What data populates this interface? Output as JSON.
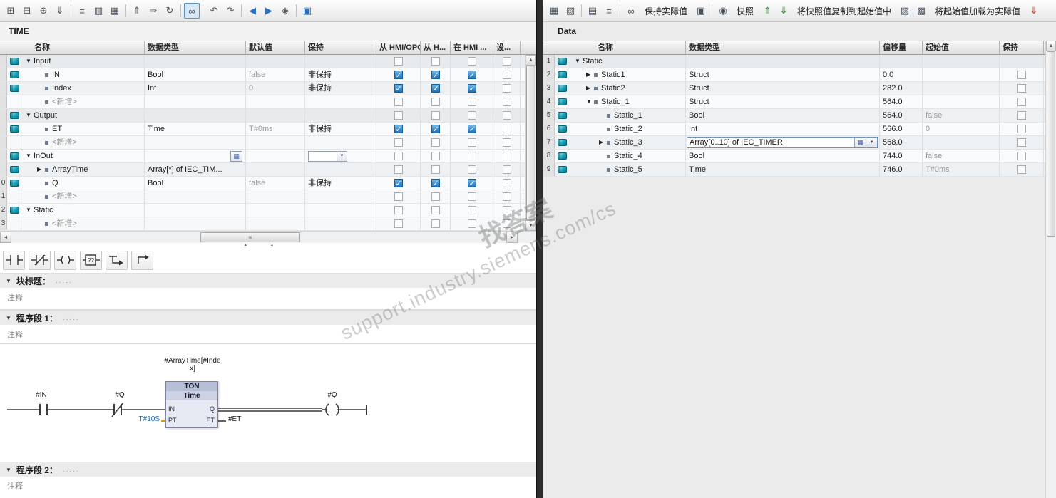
{
  "watermark": {
    "line1": "support.industry.siemens.com/cs",
    "line2": "找答案"
  },
  "left": {
    "title": "TIME",
    "toolbar": [
      {
        "icon": "insert-row-icon",
        "glyph": "⊞"
      },
      {
        "icon": "add-row-icon",
        "glyph": "⊟"
      },
      {
        "icon": "insert-parameter-icon",
        "glyph": "⊕"
      },
      {
        "icon": "move-down-icon",
        "glyph": "⇓"
      },
      {
        "icon": "separator",
        "kind": "sep"
      },
      {
        "icon": "sort-rows-icon",
        "glyph": "≡"
      },
      {
        "icon": "table-columns-icon",
        "glyph": "▥"
      },
      {
        "icon": "table-grid-icon",
        "glyph": "▦"
      },
      {
        "icon": "separator",
        "kind": "sep"
      },
      {
        "icon": "import-source-icon",
        "glyph": "⇑"
      },
      {
        "icon": "export-source-icon",
        "glyph": "⇒"
      },
      {
        "icon": "refresh-icon",
        "glyph": "↻"
      },
      {
        "icon": "separator",
        "kind": "sep"
      },
      {
        "icon": "monitor-glasses-icon",
        "glyph": "∞",
        "kind": "active"
      },
      {
        "icon": "separator",
        "kind": "sep"
      },
      {
        "icon": "undo-icon",
        "glyph": "↶"
      },
      {
        "icon": "redo-icon",
        "glyph": "↷"
      },
      {
        "icon": "separator",
        "kind": "sep"
      },
      {
        "icon": "go-previous-icon",
        "glyph": "◀",
        "tone": "blue"
      },
      {
        "icon": "go-next-icon",
        "glyph": "▶",
        "tone": "blue"
      },
      {
        "icon": "access-protection-icon",
        "glyph": "◈"
      },
      {
        "icon": "separator",
        "kind": "sep"
      },
      {
        "icon": "insert-network-icon",
        "glyph": "▣",
        "tone": "blue"
      }
    ],
    "table": {
      "headers": {
        "name": "名称",
        "dtype": "数据类型",
        "dflt": "默认值",
        "retain": "保持",
        "hmi1": "从 HMI/OPC...",
        "hmi2": "从 H...",
        "hmi3": "在 HMI ...",
        "set": "设..."
      },
      "rows": [
        {
          "num": "",
          "kind": "section",
          "varicon": "show",
          "indent": "lvl0",
          "expand": "▼",
          "name": "Input",
          "dtype": "",
          "dflt": "",
          "retain": "",
          "cb1": "empty",
          "cb2": "empty",
          "cb3": "empty",
          "cb4": "empty"
        },
        {
          "num": "",
          "kind": "member",
          "varicon": "show",
          "indent": "lvl1",
          "bullet": "show",
          "name": "IN",
          "dtype": "Bool",
          "dflt": "false",
          "retain": "非保持",
          "cb1": "checked",
          "cb2": "checked",
          "cb3": "checked",
          "cb4": "empty"
        },
        {
          "num": "",
          "kind": "member",
          "varicon": "show",
          "indent": "lvl1",
          "bullet": "show",
          "name": "Index",
          "dtype": "Int",
          "dflt": "0",
          "retain": "非保持",
          "cb1": "checked",
          "cb2": "checked",
          "cb3": "checked",
          "cb4": "empty"
        },
        {
          "num": "",
          "kind": "newrow",
          "varicon": "none",
          "indent": "lvl1",
          "bullet": "show",
          "name": "<新增>",
          "dtype": "",
          "dflt": "",
          "retain": "",
          "cb1": "empty",
          "cb2": "empty",
          "cb3": "empty",
          "cb4": "empty"
        },
        {
          "num": "",
          "kind": "section",
          "varicon": "show",
          "indent": "lvl0",
          "expand": "▼",
          "name": "Output",
          "dtype": "",
          "dflt": "",
          "retain": "",
          "cb1": "empty",
          "cb2": "empty",
          "cb3": "empty",
          "cb4": "empty"
        },
        {
          "num": "",
          "kind": "member",
          "varicon": "show",
          "indent": "lvl1",
          "bullet": "show",
          "name": "ET",
          "dtype": "Time",
          "dflt": "T#0ms",
          "retain": "非保持",
          "cb1": "checked",
          "cb2": "checked",
          "cb3": "checked",
          "cb4": "empty"
        },
        {
          "num": "",
          "kind": "newrow",
          "varicon": "none",
          "indent": "lvl1",
          "bullet": "show",
          "name": "<新增>",
          "dtype": "",
          "dflt": "",
          "retain": "",
          "cb1": "empty",
          "cb2": "empty",
          "cb3": "empty",
          "cb4": "empty"
        },
        {
          "num": "",
          "kind": "section",
          "varicon": "show",
          "indent": "lvl0",
          "expand": "▼",
          "name": "InOut",
          "dtype": "",
          "dflt": "",
          "retain": "",
          "editType": "show",
          "editRetain": "show",
          "cb1": "empty",
          "cb2": "empty",
          "cb3": "empty",
          "cb4": "empty"
        },
        {
          "num": "",
          "kind": "member",
          "varicon": "show",
          "indent": "lvl1",
          "bullet": "show",
          "expand": "▶",
          "name": "ArrayTime",
          "dtype": "Array[*] of IEC_TIM...",
          "dflt": "",
          "retain": "",
          "cb1": "empty",
          "cb2": "empty",
          "cb3": "empty",
          "cb4": "empty"
        },
        {
          "num": "0",
          "kind": "member",
          "varicon": "show",
          "indent": "lvl1",
          "bullet": "show",
          "name": "Q",
          "dtype": "Bool",
          "dflt": "false",
          "retain": "非保持",
          "cb1": "checked",
          "cb2": "checked",
          "cb3": "checked",
          "cb4": "empty"
        },
        {
          "num": "1",
          "kind": "newrow",
          "varicon": "none",
          "indent": "lvl1",
          "bullet": "show",
          "name": "<新增>",
          "dtype": "",
          "dflt": "",
          "retain": "",
          "cb1": "empty",
          "cb2": "empty",
          "cb3": "empty",
          "cb4": "empty"
        },
        {
          "num": "2",
          "kind": "section",
          "varicon": "show",
          "indent": "lvl0",
          "expand": "▼",
          "name": "Static",
          "dtype": "",
          "dflt": "",
          "retain": "",
          "cb1": "empty",
          "cb2": "empty",
          "cb3": "empty",
          "cb4": "empty"
        },
        {
          "num": "3",
          "kind": "newrow",
          "varicon": "none",
          "indent": "lvl1",
          "bullet": "show",
          "name": "<新增>",
          "dtype": "",
          "dflt": "",
          "retain": "",
          "cb1": "empty",
          "cb2": "empty",
          "cb3": "empty",
          "cb4": "empty"
        }
      ]
    },
    "ladder_toolbar": {
      "icons": [
        "no-contact-icon",
        "nc-contact-icon",
        "coil-icon",
        "empty-box-icon",
        "open-branch-icon",
        "close-branch-icon"
      ],
      "box_label": "??"
    },
    "sections": {
      "arrow": "▼",
      "block_title": "块标题：",
      "dots": ".....",
      "comment": "注释",
      "network1": "程序段 1：",
      "network2": "程序段 2："
    },
    "ladder": {
      "var_above_1": "#ArrayTime[#Inde",
      "var_above_2": "x]",
      "contact_in": "#IN",
      "contact_q": "#Q",
      "block_name": "TON",
      "block_type": "Time",
      "pin_in": "IN",
      "pin_pt": "PT",
      "pin_q": "Q",
      "pin_et": "ET",
      "pt_value": "T#10S",
      "et_var": "#ET",
      "coil_var": "#Q"
    }
  },
  "right": {
    "title": "Data",
    "toolbar": [
      {
        "kind": "icon",
        "icon": "modify-values-icon",
        "glyph": "▦"
      },
      {
        "kind": "icon",
        "icon": "edit-table-icon",
        "glyph": "▧"
      },
      {
        "kind": "sep",
        "icon": "separator"
      },
      {
        "kind": "icon",
        "icon": "expand-members-icon",
        "glyph": "▤"
      },
      {
        "kind": "icon",
        "icon": "list-view-icon",
        "glyph": "≡"
      },
      {
        "kind": "sep",
        "icon": "separator"
      },
      {
        "kind": "icon",
        "icon": "monitor-glasses-icon",
        "glyph": "∞"
      },
      {
        "kind": "button",
        "icon": "keep-actual-values-button",
        "label": "保持实际值"
      },
      {
        "kind": "icon",
        "icon": "freeze-values-icon",
        "glyph": "▣"
      },
      {
        "kind": "sep",
        "icon": "separator"
      },
      {
        "kind": "icon",
        "icon": "snapshot-camera-icon",
        "glyph": "◉"
      },
      {
        "kind": "button",
        "icon": "snapshot-button",
        "label": "快照"
      },
      {
        "kind": "icon",
        "icon": "copy-snapshot-up-icon",
        "glyph": "⇑",
        "tone": "green"
      },
      {
        "kind": "icon",
        "icon": "copy-snapshot-down-icon",
        "glyph": "⇓",
        "tone": "green"
      },
      {
        "kind": "button",
        "icon": "copy-snapshot-to-start-button",
        "label": "将快照值复制到起始值中"
      },
      {
        "kind": "icon",
        "icon": "copy-values-icon",
        "glyph": "▨"
      },
      {
        "kind": "icon",
        "icon": "paste-values-icon",
        "glyph": "▩"
      },
      {
        "kind": "button",
        "icon": "load-start-as-actual-button",
        "label": "将起始值加载为实际值"
      },
      {
        "kind": "icon",
        "icon": "download-values-icon",
        "glyph": "⇓",
        "tone": "red"
      }
    ],
    "table": {
      "headers": {
        "name": "名称",
        "dtype": "数据类型",
        "offset": "偏移量",
        "start": "起始值",
        "retain": "保持"
      },
      "rows": [
        {
          "num": "1",
          "kind": "section",
          "varicon": "show",
          "indent": "lvl0",
          "expand": "▼",
          "name": "Static",
          "dtype": "",
          "offset": "",
          "start": "",
          "cb": "none"
        },
        {
          "num": "2",
          "kind": "member",
          "varicon": "show",
          "indent": "lvl1",
          "bullet": "show",
          "expand": "▶",
          "name": "Static1",
          "dtype": "Struct",
          "offset": "0.0",
          "start": "",
          "cb": "empty"
        },
        {
          "num": "3",
          "kind": "member",
          "varicon": "show",
          "indent": "lvl1",
          "bullet": "show",
          "expand": "▶",
          "name": "Static2",
          "dtype": "Struct",
          "offset": "282.0",
          "start": "",
          "cb": "empty"
        },
        {
          "num": "4",
          "kind": "member",
          "varicon": "show",
          "indent": "lvl1",
          "bullet": "show",
          "expand": "▼",
          "name": "Static_1",
          "dtype": "Struct",
          "offset": "564.0",
          "start": "",
          "cb": "empty"
        },
        {
          "num": "5",
          "kind": "member",
          "varicon": "show",
          "indent": "lvl2",
          "bullet": "show",
          "name": "Static_1",
          "dtype": "Bool",
          "offset": "564.0",
          "start": "false",
          "cb": "empty"
        },
        {
          "num": "6",
          "kind": "member",
          "varicon": "show",
          "indent": "lvl2",
          "bullet": "show",
          "name": "Static_2",
          "dtype": "Int",
          "offset": "566.0",
          "start": "0",
          "cb": "empty"
        },
        {
          "num": "7",
          "kind": "member",
          "varicon": "show",
          "indent": "lvl2",
          "bullet": "show",
          "expand": "▶",
          "name": "Static_3",
          "dtype": "",
          "dtype_edit": "Array[0..10] of IEC_TIMER",
          "editing": "show",
          "offset": "568.0",
          "start": "",
          "cb": "empty"
        },
        {
          "num": "8",
          "kind": "member",
          "varicon": "show",
          "indent": "lvl2",
          "bullet": "show",
          "name": "Static_4",
          "dtype": "Bool",
          "offset": "744.0",
          "start": "false",
          "cb": "empty"
        },
        {
          "num": "9",
          "kind": "member",
          "varicon": "show",
          "indent": "lvl2",
          "bullet": "show",
          "name": "Static_5",
          "dtype": "Time",
          "offset": "746.0",
          "start": "T#0ms",
          "cb": "empty"
        }
      ]
    }
  }
}
